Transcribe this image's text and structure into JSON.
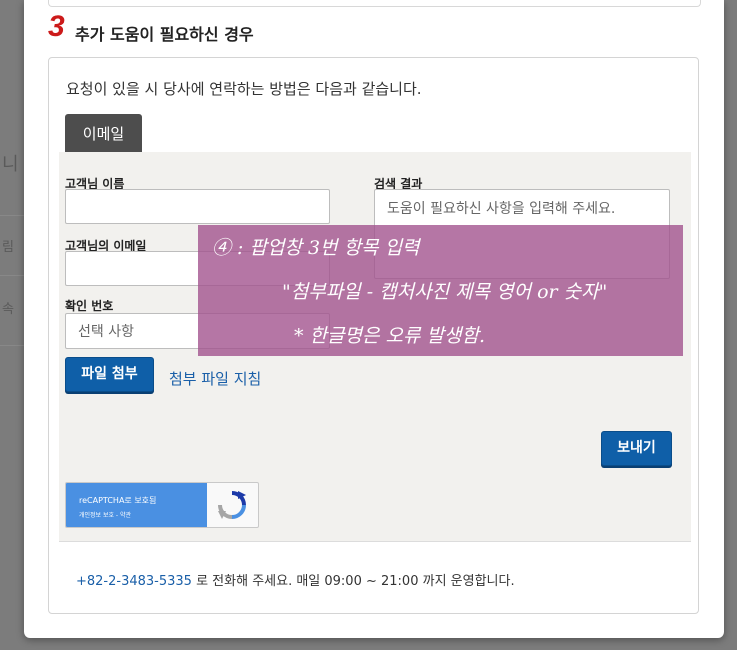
{
  "background": {
    "fragment_1": "니",
    "fragment_2": "림",
    "fragment_3": "속"
  },
  "step": {
    "number": "3",
    "title": "추가 도움이 필요하신 경우"
  },
  "contact": {
    "intro": "요청이 있을 시 당사에 연락하는 방법은 다음과 같습니다.",
    "tab_label": "이메일"
  },
  "form": {
    "name_label": "고객님 이름",
    "name_value": "",
    "email_label": "고객님의 이메일",
    "email_value": "",
    "confirm_label": "확인 번호",
    "confirm_placeholder": "선택 사항",
    "result_label": "검색 결과",
    "result_placeholder": "도움이 필요하신 사항을 입력해 주세요.",
    "attach_button": "파일 첨부",
    "attach_guide_link": "첨부 파일 지침",
    "send_button": "보내기"
  },
  "recaptcha": {
    "title": "reCAPTCHA로 보호됨",
    "links": "개인정보 보호 - 약관"
  },
  "footer": {
    "phone": "+82-2-3483-5335",
    "text": " 로 전화해 주세요. 매일 09:00 ~ 21:00 까지 운영합니다."
  },
  "annotation": {
    "color": "#a0508c",
    "line_1": "④ : 팝업창 3번 항목 입력",
    "line_2": "\"첨부파일 - 캡처사진 제목 영어 or 숫자\"",
    "line_3": "* 한글명은 오류 발생함."
  }
}
